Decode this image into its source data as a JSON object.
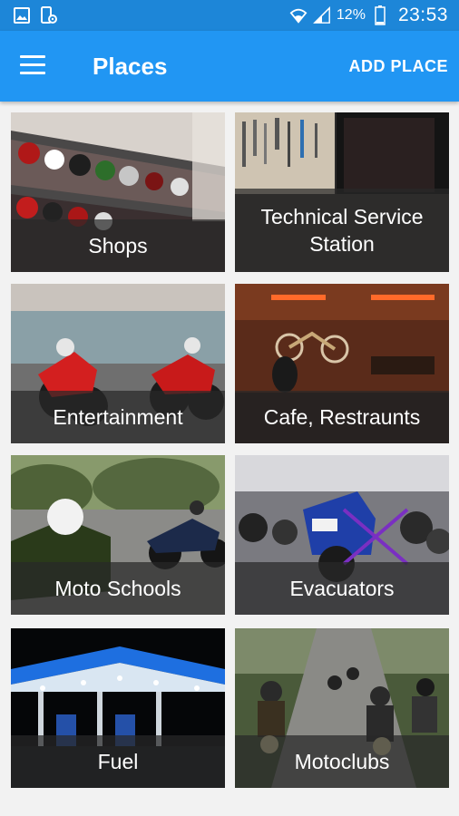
{
  "status_bar": {
    "left_icons": [
      "image-icon",
      "phone-settings-icon"
    ],
    "right_icons": [
      "wifi-icon",
      "signal-icon",
      "battery-icon"
    ],
    "battery": "12%",
    "time": "23:53"
  },
  "app_bar": {
    "menu_icon": "hamburger-menu-icon",
    "title": "Places",
    "action_label": "ADD PLACE"
  },
  "colors": {
    "status_bar": "#1d86d8",
    "app_bar": "#2196f3",
    "background": "#f2f2f2"
  },
  "tiles": [
    {
      "label": "Shops"
    },
    {
      "label": "Technical Service Station"
    },
    {
      "label": "Entertainment"
    },
    {
      "label": "Cafe, Restraunts"
    },
    {
      "label": "Moto Schools"
    },
    {
      "label": "Evacuators"
    },
    {
      "label": "Fuel"
    },
    {
      "label": "Motoclubs"
    }
  ]
}
